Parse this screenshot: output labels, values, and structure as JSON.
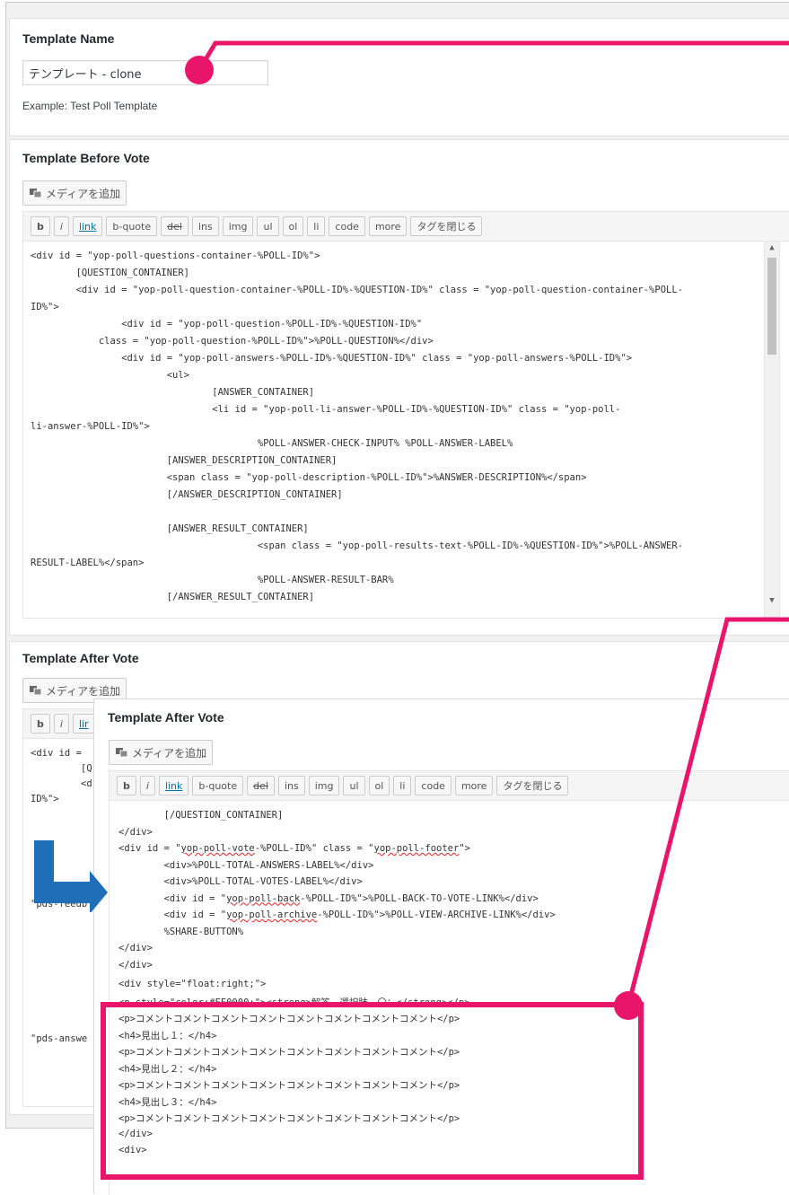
{
  "template_name": {
    "title": "Template Name",
    "value": "テンプレート - clone",
    "example": "Example: Test Poll Template"
  },
  "before_vote": {
    "title": "Template Before Vote",
    "media_button": "メディアを追加",
    "toolbar": [
      "b",
      "i",
      "link",
      "b-quote",
      "del",
      "ins",
      "img",
      "ul",
      "ol",
      "li",
      "code",
      "more",
      "タグを閉じる"
    ],
    "code_lines": [
      "<div id = \"yop-poll-questions-container-%POLL-ID%\">",
      "        [QUESTION_CONTAINER]",
      "        <div id = \"yop-poll-question-container-%POLL-ID%-%QUESTION-ID%\" class = \"yop-poll-question-container-%POLL-",
      "ID%\">",
      "                <div id = \"yop-poll-question-%POLL-ID%-%QUESTION-ID%\"",
      "            class = \"yop-poll-question-%POLL-ID%\">%POLL-QUESTION%</div>",
      "                <div id = \"yop-poll-answers-%POLL-ID%-%QUESTION-ID%\" class = \"yop-poll-answers-%POLL-ID%\">",
      "                        <ul>",
      "                                [ANSWER_CONTAINER]",
      "                                <li id = \"yop-poll-li-answer-%POLL-ID%-%QUESTION-ID%\" class = \"yop-poll-",
      "li-answer-%POLL-ID%\">",
      "                                        %POLL-ANSWER-CHECK-INPUT% %POLL-ANSWER-LABEL%",
      "                        [ANSWER_DESCRIPTION_CONTAINER]",
      "                        <span class = \"yop-poll-description-%POLL-ID%\">%ANSWER-DESCRIPTION%</span>",
      "                        [/ANSWER_DESCRIPTION_CONTAINER]",
      "",
      "                        [ANSWER_RESULT_CONTAINER]",
      "                                        <span class = \"yop-poll-results-text-%POLL-ID%-%QUESTION-ID%\">%POLL-ANSWER-",
      "RESULT-LABEL%</span>",
      "                                        %POLL-ANSWER-RESULT-BAR%",
      "                        [/ANSWER_RESULT_CONTAINER]"
    ]
  },
  "after_vote_bg": {
    "title": "Template After Vote",
    "media_button": "メディアを追加",
    "toolbar": [
      "b",
      "i",
      "lir"
    ],
    "snippets": [
      "<div id =",
      "[Q",
      "<d",
      "ID%\">",
      "\"pds-feedb",
      "\"pds-answe"
    ]
  },
  "after_vote_popup": {
    "title": "Template After Vote",
    "media_button": "メディアを追加",
    "toolbar": [
      "b",
      "i",
      "link",
      "b-quote",
      "del",
      "ins",
      "img",
      "ul",
      "ol",
      "li",
      "code",
      "more",
      "タグを閉じる"
    ],
    "code_lines": [
      "        [/QUESTION_CONTAINER]",
      "</div>",
      "<div id = \"yop-poll-vote-%POLL-ID%\" class = \"yop-poll-footer\">",
      "        <div>%POLL-TOTAL-ANSWERS-LABEL%</div>",
      "        <div>%POLL-TOTAL-VOTES-LABEL%</div>",
      "        <div id = \"yop-poll-back-%POLL-ID%\">%POLL-BACK-TO-VOTE-LINK%</div>",
      "        <div id = \"yop-poll-archive-%POLL-ID%\">%POLL-VIEW-ARCHIVE-LINK%</div>",
      "        %SHARE-BUTTON%",
      "</div>",
      "</div>"
    ],
    "highlight_lines": [
      "<div style=\"float:right;\">",
      "<p style=\"color:#FF0000;\"><strong>解答　選択肢　〇：</strong></p>",
      "<p>コメントコメントコメントコメントコメントコメントコメントコメント</p>",
      "<h4>見出し１：</h4>",
      "<p>コメントコメントコメントコメントコメントコメントコメントコメント</p>",
      "<h4>見出し２：</h4>",
      "<p>コメントコメントコメントコメントコメントコメントコメントコメント</p>",
      "<h4>見出し３：</h4>",
      "<p>コメントコメントコメントコメントコメントコメントコメントコメント</p>",
      "</div>",
      "<div>"
    ]
  },
  "colors": {
    "highlight": "#e8156b",
    "arrow": "#1f6fb8",
    "link": "#0073aa"
  }
}
